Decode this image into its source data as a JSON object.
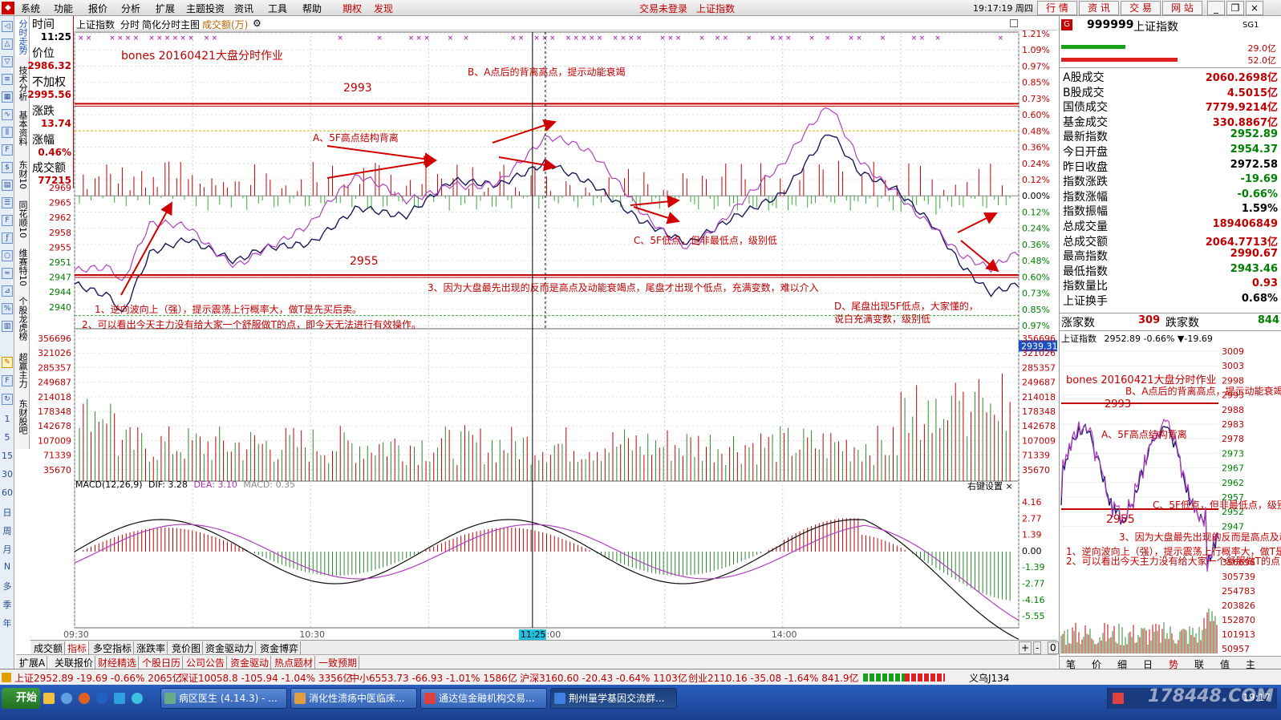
{
  "menubar": {
    "items": [
      "系统",
      "功能",
      "报价",
      "分析",
      "扩展",
      "主题投资",
      "资讯",
      "工具",
      "帮助"
    ],
    "extra": [
      "期权",
      "发现"
    ],
    "status_login": "交易未登录",
    "status_index": "上证指数",
    "clock": "19:17:19 周四",
    "right_tabs": [
      "行 情",
      "资 讯",
      "交 易",
      "网 站"
    ]
  },
  "left_vtabs": [
    "分时走势",
    "技术分析",
    "基本资料",
    "东财10",
    "同花顺10",
    "维赛特10",
    "个股龙虎榜",
    "超赢主力",
    "东财股吧"
  ],
  "left_nav_nums": [
    "1",
    "5",
    "15",
    "30",
    "60",
    "日",
    "周",
    "月",
    "N",
    "多",
    "季",
    "年"
  ],
  "info": {
    "time_label": "时间",
    "time_value": "11:25",
    "price_label": "价位",
    "price_value": "2986.32",
    "noadj_label": "不加权",
    "noadj_value": "2995.56",
    "chg_label": "涨跌",
    "chg_value": "13.74",
    "pct_label": "涨幅",
    "pct_value": "0.46%",
    "amt_label": "成交额",
    "amt_value": "77215"
  },
  "chart_header": {
    "name": "上证指数",
    "mode": "分时",
    "sub": "简化分时主图",
    "series": "成交额(万)"
  },
  "macd_header": {
    "name": "MACD(12,26,9)",
    "dif": "DIF: 3.28",
    "dea": "DEA: 3.10",
    "macd": "MACD: 0.35",
    "settings": "右键设置"
  },
  "annotations": {
    "title": "bones 20160421大盘分时作业",
    "b": "B、A点后的背离高点，提示动能衰竭",
    "a": "A、5F高点结构背离",
    "c": "C、5F低点，但非最低点，级别低",
    "n3": "3、因为大盘最先出现的反而是高点及动能衰竭点，尾盘才出现个低点，充满变数，难以介入",
    "n1": "1、逆向波向上（强），提示震荡上行概率大，做T是先买后卖。",
    "n2": "2、可以看出今天主力没有给大家一个舒服做T的点，即今天无法进行有效操作。",
    "d1": "D、尾盘出现5F低点，大家懂的，",
    "d2": "说白充满变数，级别低",
    "l2993": "2993",
    "l2955": "2955"
  },
  "price_axis": {
    "left": [
      "2969",
      "2965",
      "2962",
      "2958",
      "2955",
      "2951",
      "2947",
      "2944",
      "2940"
    ],
    "right": [
      "1.21%",
      "1.09%",
      "0.97%",
      "0.85%",
      "0.73%",
      "0.60%",
      "0.48%",
      "0.36%",
      "0.24%",
      "0.12%",
      "0.00%",
      "0.12%",
      "0.24%",
      "0.36%",
      "0.48%",
      "0.60%",
      "0.73%",
      "0.85%",
      "0.97%"
    ],
    "cursor_value": "2939.31"
  },
  "volume_axis": [
    "356696",
    "321026",
    "285357",
    "249687",
    "214018",
    "178348",
    "142678",
    "107009",
    "71339",
    "35670"
  ],
  "macd_axis": [
    "4.16",
    "2.77",
    "1.39",
    "0.00",
    "-1.39",
    "-2.77",
    "-4.16",
    "-5.55"
  ],
  "time_axis": {
    "labels": [
      "09:30",
      "10:30",
      "13:00",
      "14:00"
    ],
    "cursor": "11:25"
  },
  "bottom_tabs": [
    "成交额",
    "指标",
    "多空指标",
    "涨跌率",
    "竞价图",
    "资金驱动力",
    "资金博弈"
  ],
  "bottom_tabs2": [
    "扩展A",
    "关联报价",
    "财经精选",
    "个股日历",
    "公司公告",
    "资金驱动",
    "热点题材",
    "一致预期"
  ],
  "zoom_controls": [
    "+",
    "-",
    "0"
  ],
  "right_panel": {
    "code": "999999",
    "name": "上证指数",
    "badge": "SG1",
    "vol1": "29.0亿",
    "vol2": "52.0亿",
    "rows": [
      {
        "k": "A股成交",
        "v": "2060.2698亿",
        "c": "#c00000"
      },
      {
        "k": "B股成交",
        "v": "4.5015亿",
        "c": "#c00000"
      },
      {
        "k": "国债成交",
        "v": "7779.9214亿",
        "c": "#c00000"
      },
      {
        "k": "基金成交",
        "v": "330.8867亿",
        "c": "#c00000"
      },
      {
        "k": "最新指数",
        "v": "2952.89",
        "c": "#008000"
      },
      {
        "k": "今日开盘",
        "v": "2954.37",
        "c": "#008000"
      },
      {
        "k": "昨日收盘",
        "v": "2972.58",
        "c": "#000000"
      },
      {
        "k": "指数涨跌",
        "v": "-19.69",
        "c": "#008000"
      },
      {
        "k": "指数涨幅",
        "v": "-0.66%",
        "c": "#008000"
      },
      {
        "k": "指数振幅",
        "v": "1.59%",
        "c": "#000000"
      },
      {
        "k": "总成交量",
        "v": "189406849",
        "c": "#c00000"
      },
      {
        "k": "总成交额",
        "v": "2064.7713亿",
        "c": "#c00000"
      },
      {
        "k": "最高指数",
        "v": "2990.67",
        "c": "#c00000"
      },
      {
        "k": "最低指数",
        "v": "2943.46",
        "c": "#008000"
      },
      {
        "k": "指数量比",
        "v": "0.93",
        "c": "#c00000"
      },
      {
        "k": "上证换手",
        "v": "0.68%",
        "c": "#000000"
      }
    ],
    "rise_label": "涨家数",
    "rise": "309",
    "fall_label": "跌家数",
    "fall": "844",
    "mini_header": "上证指数",
    "mini_header_vals": "2952.89 -0.66% ▼-19.69",
    "mini_axis": [
      "3009",
      "3003",
      "2998",
      "2993",
      "2988",
      "2983",
      "2978",
      "2973",
      "2967",
      "2962",
      "2957",
      "2952",
      "2947"
    ],
    "mini_vol_axis": [
      "356696",
      "305739",
      "254783",
      "203826",
      "152870",
      "101913",
      "50957"
    ],
    "bottom_tabs": [
      "笔",
      "价",
      "细",
      "日",
      "势",
      "联",
      "值",
      "主"
    ]
  },
  "statusbar": {
    "sh": "上证2952.89 -19.69 -0.66% 2065亿",
    "sz": "深证10058.8 -105.94 -1.04% 3356亿",
    "zx": "中小6553.73 -66.93 -1.01% 1586亿",
    "hs": "沪深3160.60 -20.43 -0.64% 1103亿",
    "cy": "创业2110.16 -35.08 -1.64% 841.9亿",
    "server": "义乌J134"
  },
  "taskbar": {
    "start": "开始",
    "tasks": [
      "病区医生 (4.14.3) - ...",
      "消化性溃疡中医临床...",
      "通达信金融机构交易...",
      "荆州量学基因交流群..."
    ],
    "clock": "19:17",
    "watermark": "178448.COM"
  },
  "chart_data": {
    "type": "line",
    "title": "上证指数 分时",
    "x": [
      "09:30",
      "10:30",
      "11:25",
      "13:00",
      "14:00"
    ],
    "series": [
      {
        "name": "上证指数",
        "points": [
          [
            0,
            2953
          ],
          [
            0.04,
            2950
          ],
          [
            0.05,
            2946
          ],
          [
            0.08,
            2960
          ],
          [
            0.12,
            2963
          ],
          [
            0.17,
            2958
          ],
          [
            0.2,
            2961
          ],
          [
            0.25,
            2962
          ],
          [
            0.3,
            2970
          ],
          [
            0.35,
            2968
          ],
          [
            0.4,
            2976
          ],
          [
            0.45,
            2975
          ],
          [
            0.5,
            2980
          ],
          [
            0.55,
            2975
          ],
          [
            0.6,
            2967
          ],
          [
            0.65,
            2962
          ],
          [
            0.7,
            2968
          ],
          [
            0.75,
            2973
          ],
          [
            0.8,
            2987
          ],
          [
            0.83,
            2978
          ],
          [
            0.87,
            2974
          ],
          [
            0.91,
            2966
          ],
          [
            0.94,
            2957
          ],
          [
            0.97,
            2951
          ],
          [
            1,
            2953
          ]
        ]
      }
    ],
    "ylim": [
      2940,
      2998
    ],
    "annotations": [
      "2993",
      "2955"
    ]
  }
}
